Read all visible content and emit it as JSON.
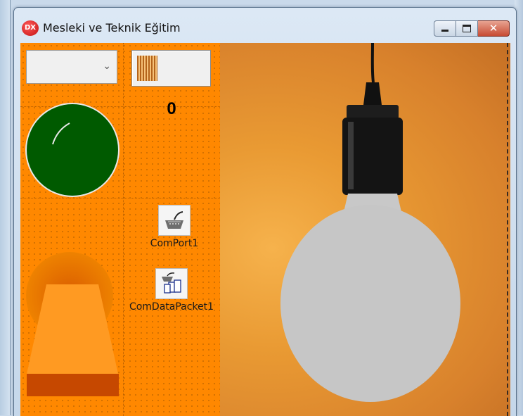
{
  "window": {
    "title": "Mesleki ve Teknik Eğitim",
    "app_icon_text": "DX",
    "buttons": {
      "minimize": "minimize",
      "maximize": "maximize",
      "close": "✕"
    }
  },
  "form": {
    "combo": {
      "value": ""
    },
    "gauge": {
      "progress": 0.3
    },
    "counter": "0",
    "dial": {
      "color": "#005a00"
    },
    "components": [
      {
        "label": "ComPort1",
        "icon": "comport-icon"
      },
      {
        "label": "ComDataPacket1",
        "icon": "comdatapacket-icon"
      }
    ]
  },
  "colors": {
    "form_bg": "#ff8800",
    "dial": "#005a00",
    "lamp": "#ff9a22",
    "lamp_base": "#c64800"
  }
}
